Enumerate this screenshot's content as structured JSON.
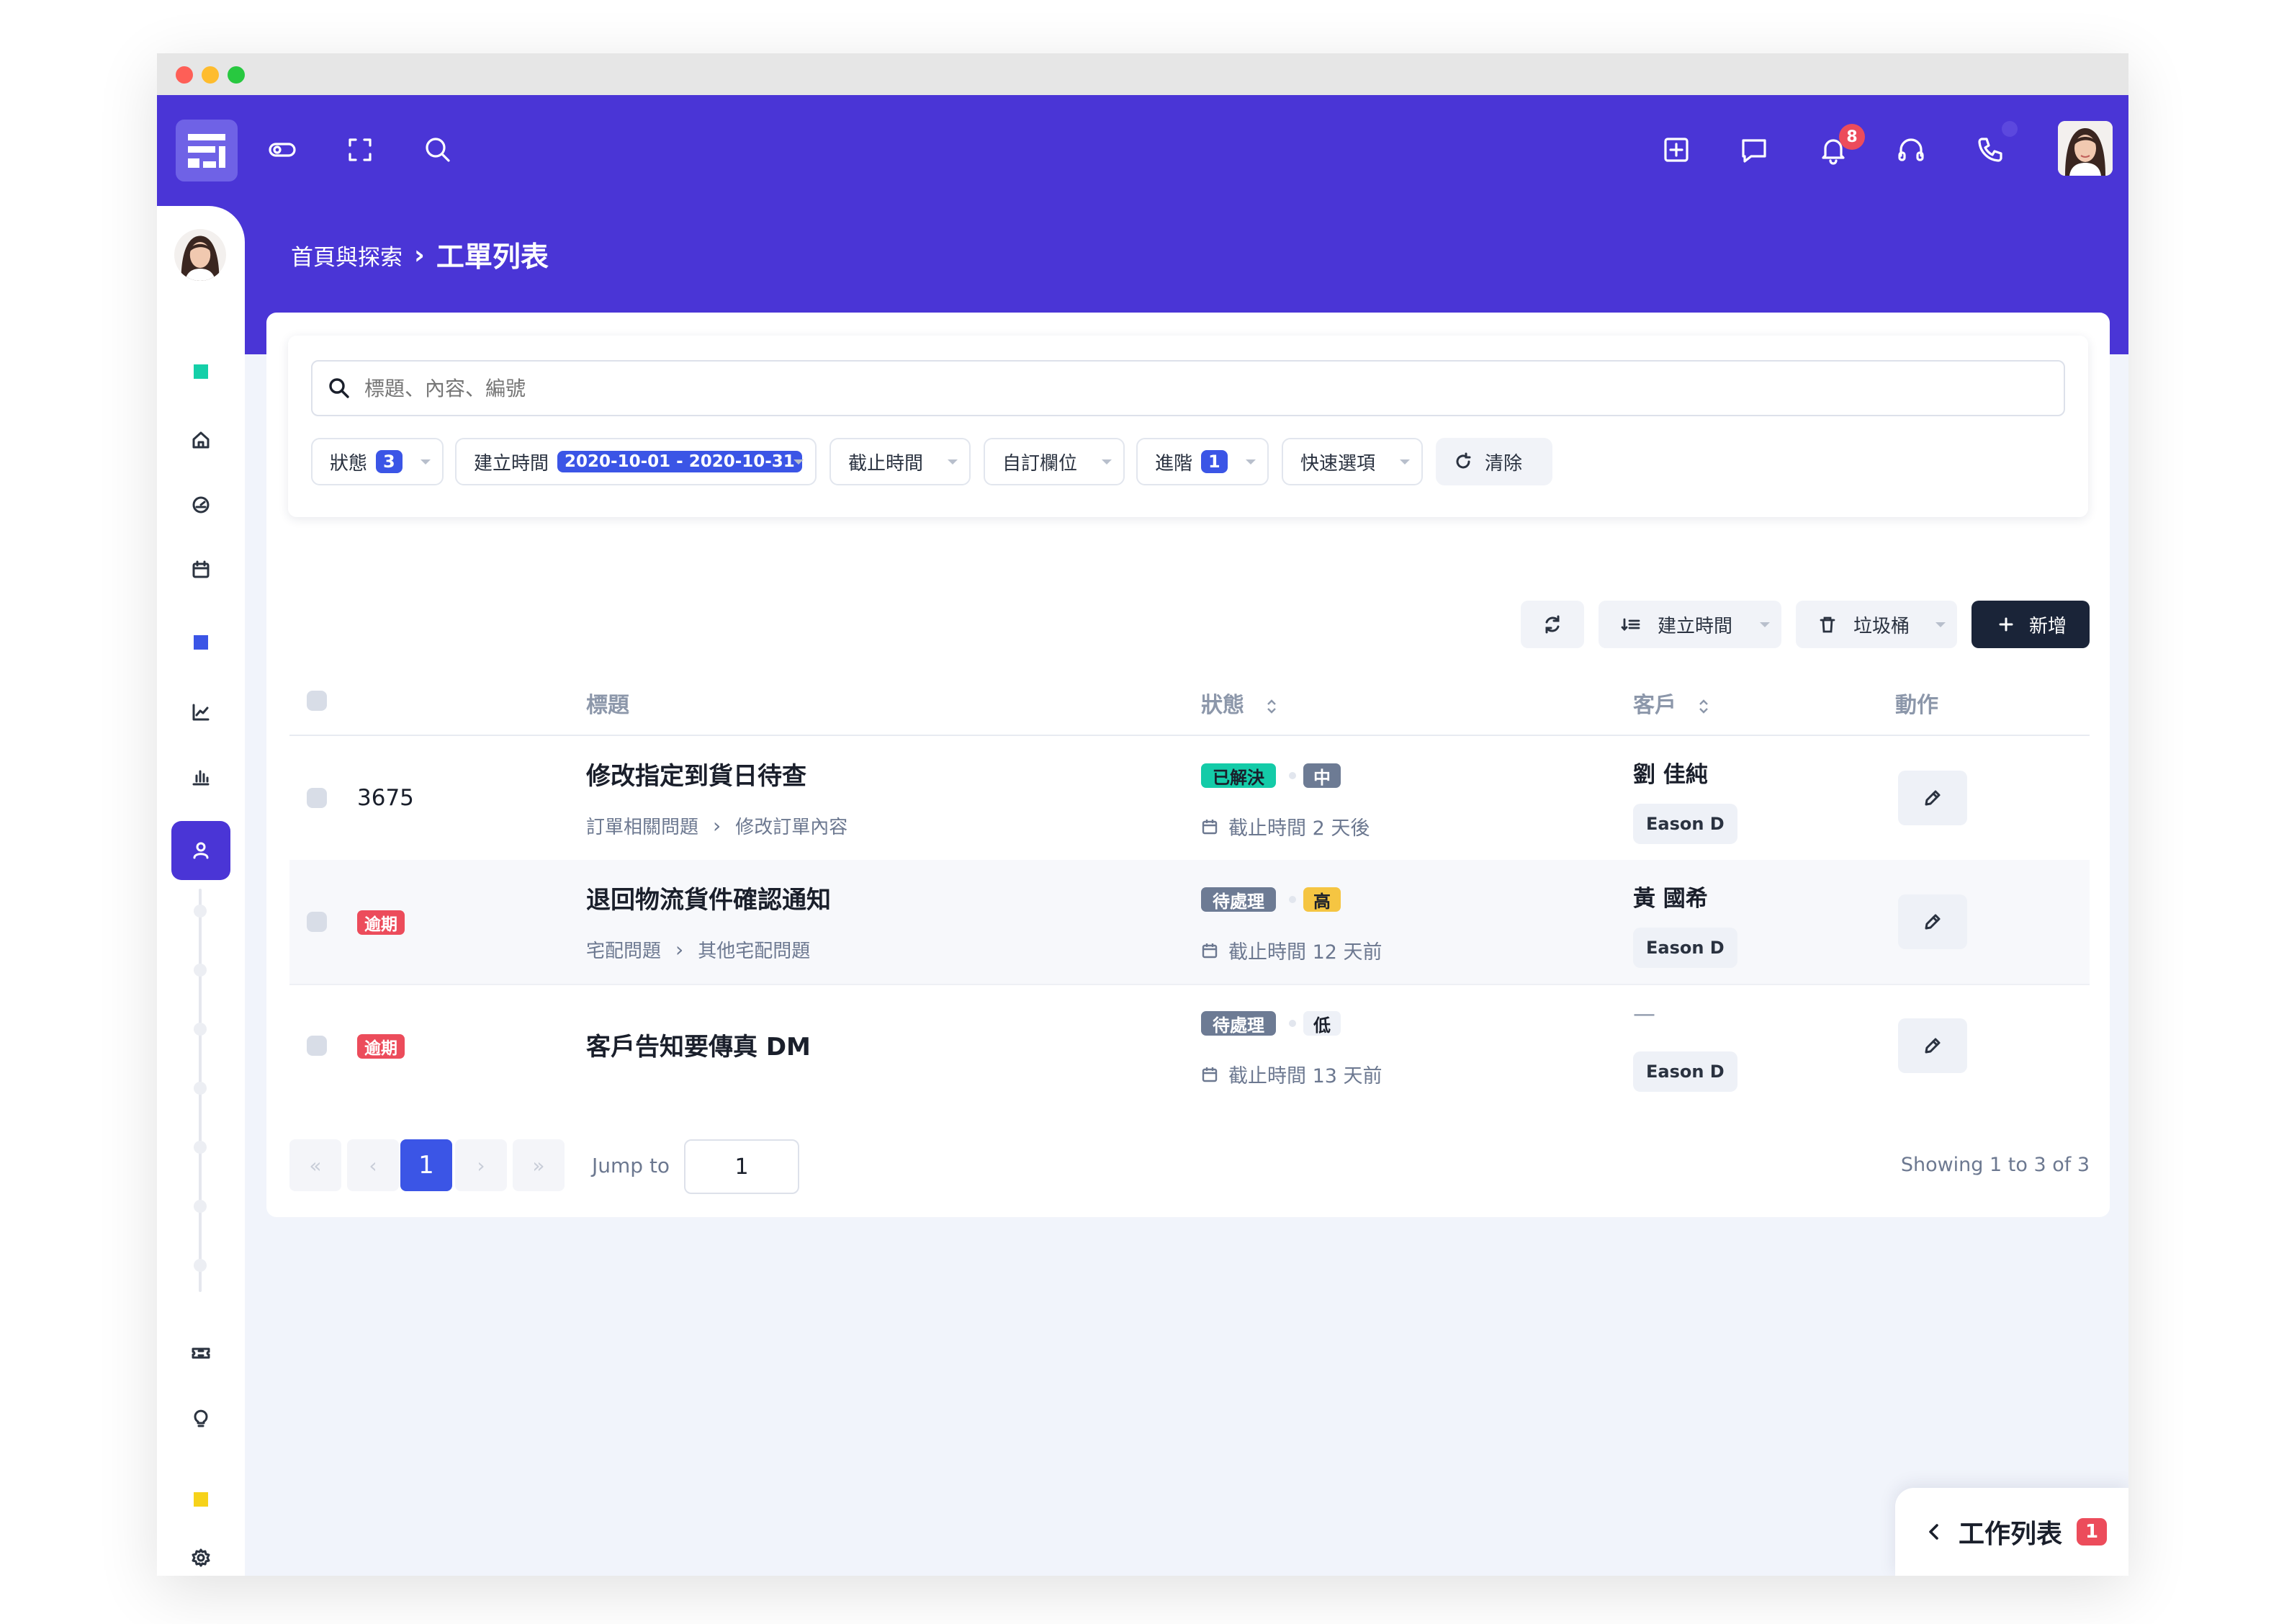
{
  "header": {
    "notification_count": "8"
  },
  "breadcrumb": {
    "parent": "首頁與探索",
    "separator": "›",
    "current": "工單列表"
  },
  "search": {
    "placeholder": "標題、內容、編號"
  },
  "filters": {
    "status_label": "狀態",
    "status_count": "3",
    "created_label": "建立時間",
    "created_range": "2020-10-01 - 2020-10-31",
    "deadline_label": "截止時間",
    "custom_label": "自訂欄位",
    "advanced_label": "進階",
    "advanced_count": "1",
    "quick_label": "快速選項",
    "clear_label": "清除"
  },
  "toolbar": {
    "sort_label": "建立時間",
    "trash_label": "垃圾桶",
    "new_label": "新增"
  },
  "table": {
    "col_title": "標題",
    "col_status": "狀態",
    "col_customer": "客戶",
    "col_action": "動作",
    "rows": [
      {
        "id": "3675",
        "title": "修改指定到貨日待查",
        "category": "訂單相關問題",
        "subcategory": "修改訂單內容",
        "status": "已解決",
        "priority": "中",
        "deadline": "截止時間 2 天後",
        "customer": "劉 佳純",
        "agent": "Eason D"
      },
      {
        "overdue": "逾期",
        "title": "退回物流貨件確認通知",
        "category": "宅配問題",
        "subcategory": "其他宅配問題",
        "status": "待處理",
        "priority": "高",
        "deadline": "截止時間 12 天前",
        "customer": "黃 國希",
        "agent": "Eason D"
      },
      {
        "overdue": "逾期",
        "title": "客戶告知要傳真 DM",
        "status": "待處理",
        "priority": "低",
        "deadline": "截止時間 13 天前",
        "customer": "—",
        "agent": "Eason D"
      }
    ]
  },
  "pagination": {
    "first": "«",
    "prev": "‹",
    "current": "1",
    "next": "›",
    "last": "»",
    "jump_label": "Jump to",
    "jump_value": "1",
    "showing": "Showing 1 to 3 of 3"
  },
  "worklist": {
    "label": "工作列表",
    "count": "1"
  },
  "colors": {
    "brand": "#4a35d6",
    "resolved": "#14cba8",
    "pending": "#6d7b94",
    "medium": "#6d7b94",
    "high": "#f5c542",
    "overdue": "#ec4c5b",
    "primary_dark": "#1a2438"
  }
}
